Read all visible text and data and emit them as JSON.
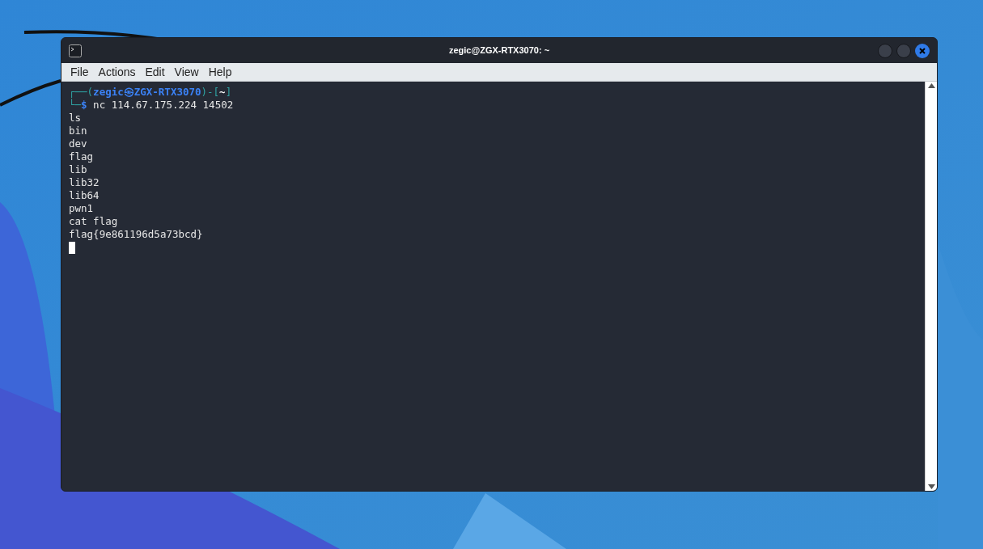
{
  "window": {
    "title": "zegic@ZGX-RTX3070: ~"
  },
  "menu": [
    "File",
    "Actions",
    "Edit",
    "View",
    "Help"
  ],
  "terminal": {
    "prompt_line": [
      {
        "text": "┌──(",
        "kind": "frame"
      },
      {
        "text": "zegic㉿ZGX-RTX3070",
        "kind": "host"
      },
      {
        "text": ")-[",
        "kind": "frame"
      },
      {
        "text": "~",
        "kind": "path"
      },
      {
        "text": "]",
        "kind": "frame"
      }
    ],
    "command_line": [
      {
        "text": "└─",
        "kind": "frame"
      },
      {
        "text": "$",
        "kind": "host"
      },
      {
        "text": " nc 114.67.175.224 14502",
        "kind": "plain"
      }
    ],
    "output": [
      "ls",
      "bin",
      "dev",
      "flag",
      "lib",
      "lib32",
      "lib64",
      "pwn1",
      "cat flag",
      "flag{9e861196d5a73bcd}"
    ]
  }
}
